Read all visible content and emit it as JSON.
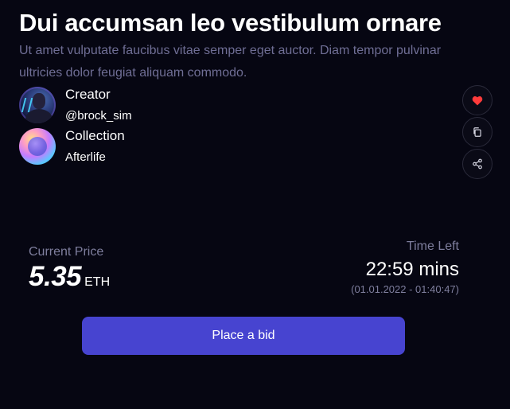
{
  "item": {
    "title": "Dui accumsan leo vestibulum ornare",
    "description": "Ut amet vulputate faucibus vitae semper eget auctor. Diam tempor pulvinar ultricies dolor feugiat aliquam commodo."
  },
  "creator": {
    "label": "Creator",
    "handle": "@brock_sim"
  },
  "collection": {
    "label": "Collection",
    "name": "Afterlife"
  },
  "actions": {
    "like_icon": "heart-icon",
    "copy_icon": "copy-icon",
    "share_icon": "share-icon"
  },
  "price": {
    "label": "Current Price",
    "value": "5.35",
    "currency": "ETH"
  },
  "time": {
    "label": "Time Left",
    "remaining": "22:59 mins",
    "range": "(01.01.2022 - 01:40:47)"
  },
  "bid_button": {
    "label": "Place a bid"
  },
  "colors": {
    "background": "#060612",
    "accent": "#4744d0",
    "muted_text": "#7e7e9d",
    "heart": "#ff3b3b"
  }
}
